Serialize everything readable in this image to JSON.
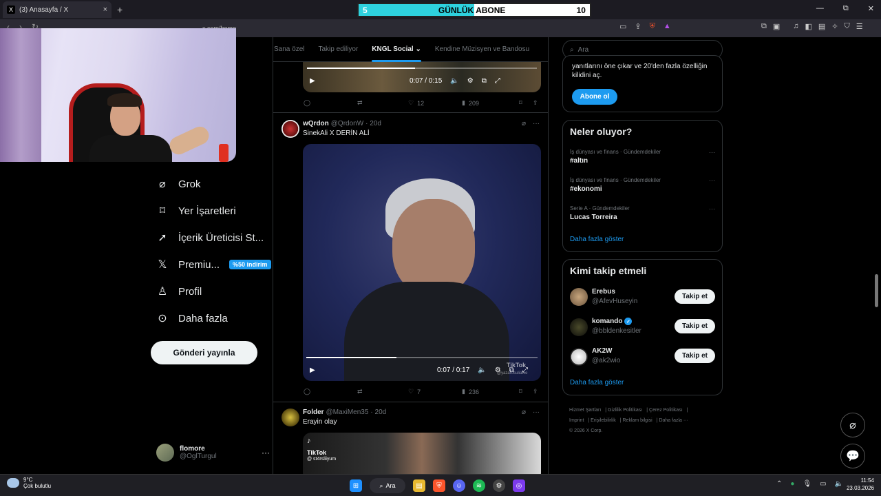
{
  "browser": {
    "tab_title": "(3) Anasayfa / X",
    "tab_favicon": "X",
    "tab_close": "×",
    "new_tab": "+",
    "url": "x.com/home",
    "window_controls": [
      "—",
      "⧉",
      "✕"
    ]
  },
  "overlay": {
    "left_number": "5",
    "label": "GÜNLÜK ABONE",
    "right_number": "10",
    "progress_fraction": 0.5,
    "fill_color": "#2ed1de"
  },
  "nav": {
    "items": [
      {
        "label": "Grok",
        "icon": "grok-icon"
      },
      {
        "label": "Yer İşaretleri",
        "icon": "bookmark-icon"
      },
      {
        "label": "İçerik Üreticisi St...",
        "icon": "rocket-icon"
      },
      {
        "label": "Premiu...",
        "icon": "x-logo-icon"
      },
      {
        "label": "Profil",
        "icon": "person-icon"
      },
      {
        "label": "Daha fazla",
        "icon": "more-circle-icon"
      }
    ],
    "premium_badge": "%50 indirim",
    "post_button": "Gönderi yayınla",
    "account": {
      "name": "flomore",
      "handle": "@OglTurgul",
      "more": "···"
    }
  },
  "timeline": {
    "tabs": [
      "Sana özel",
      "Takip ediliyor",
      "KNGL Social",
      "Kendine Müzisyen ve Bandosu"
    ],
    "active_tab": "KNGL Social",
    "tweet0": {
      "video_time": "0:07 / 0:15",
      "progress_fraction": 0.47,
      "replies": "",
      "retweets": "",
      "likes": "12",
      "views": "209"
    },
    "tweet1": {
      "name": "wQrdon",
      "handle": "@QrdonW",
      "time": "· 20d",
      "text": "SinekAli   X    DERİN ALİ",
      "video_time": "0:07 / 0:17",
      "progress_fraction": 0.39,
      "watermark": "TikTok",
      "watermark_handle": "@yazarosuliatve",
      "likes": "7",
      "views": "236"
    },
    "tweet2": {
      "name": "Folder",
      "handle": "@MaxiMen35",
      "time": "· 20d",
      "text": "Erayin olay",
      "watermark": "TikTok",
      "watermark_handle": "@ st4rsliiyum"
    }
  },
  "right": {
    "search_placeholder": "Ara",
    "premium_card": {
      "text": "yanıtlarını öne çıkar ve 20'den fazla özelliğin kilidini aç.",
      "button": "Abone ol"
    },
    "trends_title": "Neler oluyor?",
    "trends": [
      {
        "meta": "İş dünyası ve finans · Gündemdekiler",
        "name": "#altın"
      },
      {
        "meta": "İş dünyası ve finans · Gündemdekiler",
        "name": "#ekonomi"
      },
      {
        "meta": "Serie A · Gündemdekiler",
        "name": "Lucas Torreira"
      }
    ],
    "show_more": "Daha fazla göster",
    "wtf_title": "Kimi takip etmeli",
    "wtf": [
      {
        "name": "Erebus",
        "handle": "@AfevHuseyin",
        "verified": false
      },
      {
        "name": "komando",
        "handle": "@bbldenkesitler",
        "verified": true
      },
      {
        "name": "AK2W",
        "handle": "@ak2wio",
        "verified": false
      }
    ],
    "follow_label": "Takip et",
    "footer": [
      "Hizmet Şartları",
      "Gizlilik Politikası",
      "Çerez Politikası",
      "Imprint",
      "Erişilebilirlik",
      "Reklam bilgisi",
      "Daha fazla ···",
      "© 2026 X Corp."
    ]
  },
  "taskbar": {
    "temp": "9°C",
    "weather": "Çok bulutlu",
    "search": "Ara",
    "time": "11:54",
    "date": "23.03.2026"
  },
  "colors": {
    "accent": "#1d9bf0",
    "background": "#000000",
    "border": "#2f3336",
    "muted": "#71767b"
  }
}
